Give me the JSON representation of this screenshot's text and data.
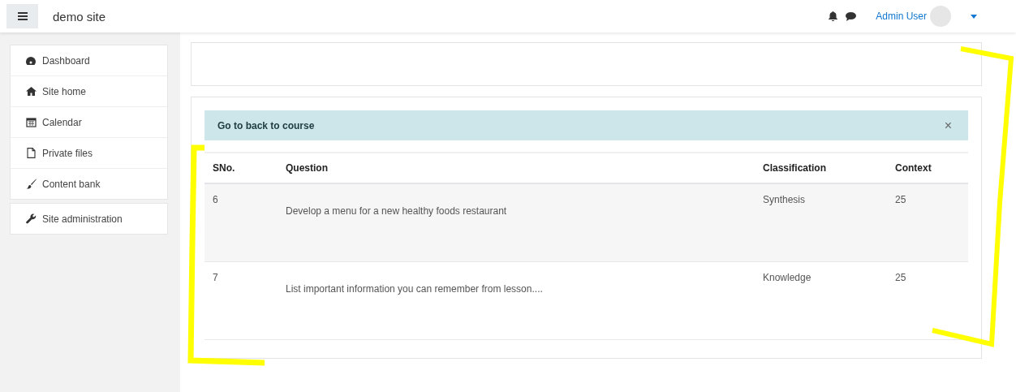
{
  "header": {
    "site_name": "demo site",
    "user_name": "Admin User"
  },
  "sidebar": {
    "groups": [
      {
        "items": [
          {
            "label": "Dashboard"
          },
          {
            "label": "Site home"
          },
          {
            "label": "Calendar"
          },
          {
            "label": "Private files"
          },
          {
            "label": "Content bank"
          }
        ]
      },
      {
        "items": [
          {
            "label": "Site administration"
          }
        ]
      }
    ]
  },
  "alert": {
    "text": "Go to back to course",
    "close": "×"
  },
  "table": {
    "columns": [
      "SNo.",
      "Question",
      "Classification",
      "Context"
    ],
    "rows": [
      {
        "sno": "6",
        "question": "Develop a menu for a new healthy foods restaurant",
        "classification": "Synthesis",
        "context": "25"
      },
      {
        "sno": "7",
        "question": "List important information you can remember from lesson....",
        "classification": "Knowledge",
        "context": "25"
      }
    ]
  }
}
